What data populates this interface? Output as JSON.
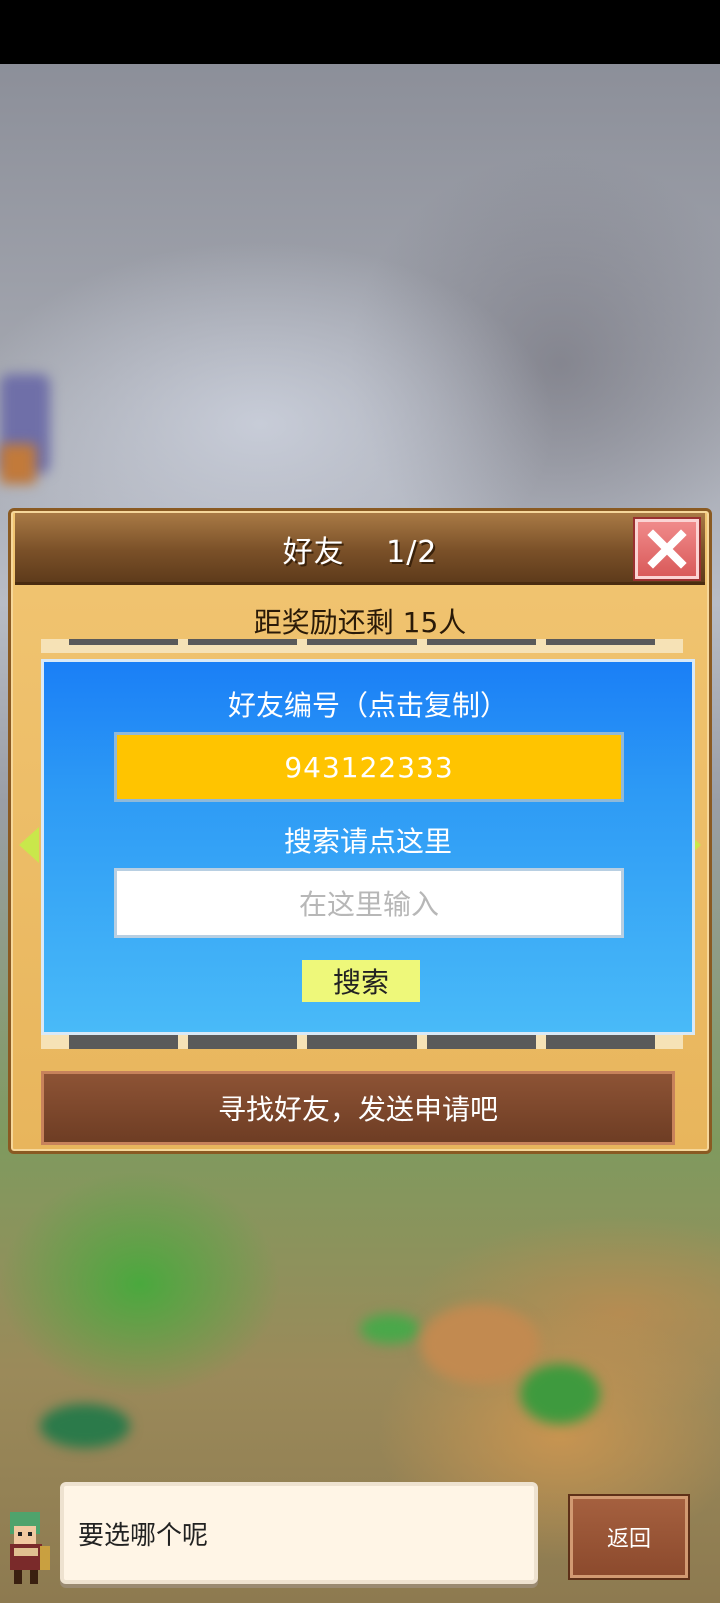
{
  "dialog": {
    "title": "好友 　1/2",
    "reward_text": "距奖励还剩 15人",
    "friend_id_label": "好友编号（点击复制）",
    "friend_id": "943122333",
    "search_label": "搜索请点这里",
    "search_placeholder": "在这里输入",
    "search_button": "搜索",
    "banner": "寻找好友，发送申请吧"
  },
  "bottom": {
    "speech": "要选哪个呢",
    "back_button": "返回"
  },
  "colors": {
    "friend_id_bg": "#ffc400",
    "search_button_bg": "#eef87a",
    "arrow": "#c9e74b"
  },
  "icons": {
    "close": "close-icon",
    "left": "left-arrow-icon",
    "right": "right-arrow-icon"
  }
}
